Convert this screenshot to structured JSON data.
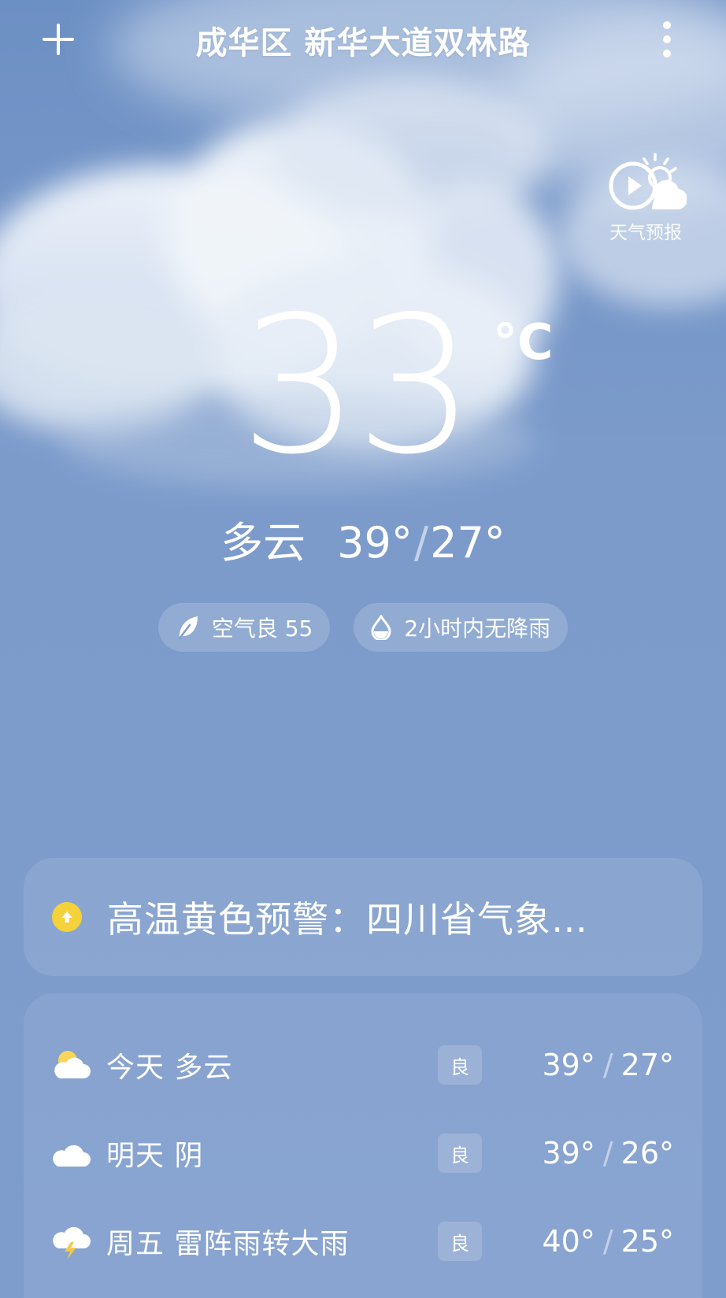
{
  "header": {
    "location": "成华区 新华大道双林路",
    "add_icon": "plus-icon",
    "more_icon": "more-vertical-icon"
  },
  "forecast_video": {
    "label": "天气预报",
    "icon": "weather-video-icon"
  },
  "current": {
    "temperature": "33",
    "unit": "°C",
    "condition": "多云",
    "high": "39°",
    "separator": "/",
    "low": "27°"
  },
  "chips": [
    {
      "icon": "leaf-icon",
      "text": "空气良 55"
    },
    {
      "icon": "water-drop-icon",
      "text": "2小时内无降雨"
    }
  ],
  "alert": {
    "icon": "warning-up-arrow-icon",
    "color": "#f6d23a",
    "text": "高温黄色预警：四川省气象…"
  },
  "daily": [
    {
      "icon": "partly-cloudy-icon",
      "label": "今天  多云",
      "aqi": "良",
      "high": "39°",
      "sep": "/",
      "low": "27°"
    },
    {
      "icon": "overcast-icon",
      "label": "明天  阴",
      "aqi": "良",
      "high": "39°",
      "sep": "/",
      "low": "26°"
    },
    {
      "icon": "thunderstorm-icon",
      "label": "周五  雷阵雨转大雨",
      "aqi": "良",
      "high": "40°",
      "sep": "/",
      "low": "25°"
    }
  ],
  "colors": {
    "sky_top": "#6d90c4",
    "sky_bottom": "#7f9dcc",
    "alert_yellow": "#f6d23a"
  }
}
